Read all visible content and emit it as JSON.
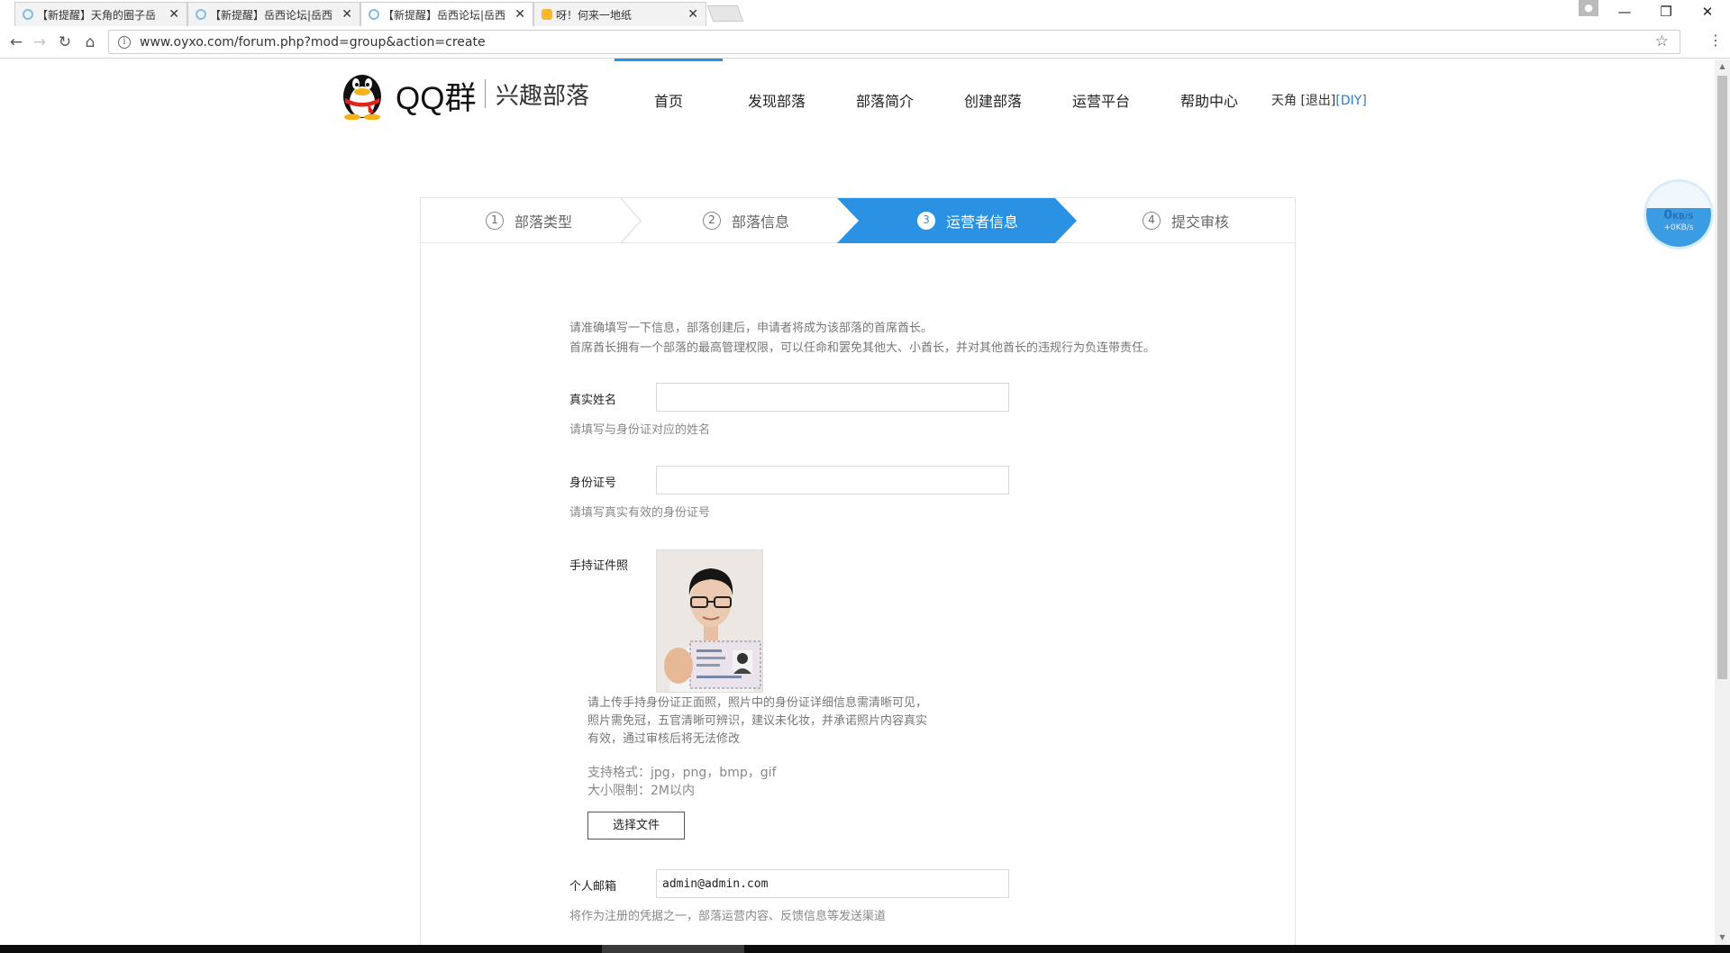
{
  "browser": {
    "tabs": [
      {
        "title": "【新提醒】天角的圈子岳",
        "active": false
      },
      {
        "title": "【新提醒】岳西论坛|岳西",
        "active": false
      },
      {
        "title": "【新提醒】岳西论坛|岳西",
        "active": true
      },
      {
        "title": "呀！何来一地纸",
        "active": false
      }
    ],
    "url": "www.oyxo.com/forum.php?mod=group&action=create"
  },
  "header": {
    "logo_text": "QQ群",
    "logo_subtitle": "兴趣部落",
    "nav": [
      "首页",
      "发现部落",
      "部落简介",
      "创建部落",
      "运营平台",
      "帮助中心"
    ],
    "user": "天角",
    "logout": "[退出]",
    "diy": "[DIY]"
  },
  "steps": [
    {
      "num": "1",
      "label": "部落类型"
    },
    {
      "num": "2",
      "label": "部落信息"
    },
    {
      "num": "3",
      "label": "运营者信息"
    },
    {
      "num": "4",
      "label": "提交审核"
    }
  ],
  "form": {
    "intro_line1": "请准确填写一下信息，部落创建后，申请者将成为该部落的首席酋长。",
    "intro_line2": "首席酋长拥有一个部落的最高管理权限，可以任命和罢免其他大、小酋长，并对其他酋长的违规行为负连带责任。",
    "real_name_label": "真实姓名",
    "real_name_value": "",
    "real_name_hint": "请填写与身份证对应的姓名",
    "id_label": "身份证号",
    "id_value": "",
    "id_hint": "请填写真实有效的身份证号",
    "photo_label": "手持证件照",
    "upload_note_1": "请上传手持身份证正面照，照片中的身份证详细信息需清晰可见，",
    "upload_note_2": "照片需免冠，五官清晰可辨识，建议未化妆，并承诺照片内容真实",
    "upload_note_3": "有效，通过审核后将无法修改",
    "format_text": "支持格式：jpg，png，bmp，gif",
    "size_text": "大小限制：2M以内",
    "file_button": "选择文件",
    "email_label": "个人邮箱",
    "email_value": "admin@admin.com",
    "email_hint": "将作为注册的凭据之一，部落运营内容、反馈信息等发送渠道"
  },
  "speed_widget": {
    "main": "0",
    "unit": "KB/S",
    "sub": "+0KB/s"
  },
  "colors": {
    "accent": "#2b92e3",
    "link": "#2b7cc7"
  }
}
